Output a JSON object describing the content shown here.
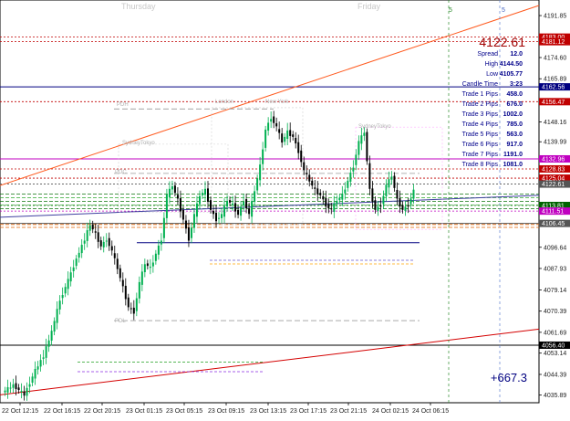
{
  "chart_data": {
    "type": "candlestick",
    "symbol_price": "4122.61",
    "y_range": [
      4035,
      4196
    ],
    "y_ticks": [
      "4191.85",
      "4183.00",
      "4181.12",
      "4174.60",
      "4165.89",
      "4162.56",
      "4156.47",
      "4148.16",
      "4139.99",
      "4132.96",
      "4128.83",
      "4125.04",
      "4122.61",
      "4113.81",
      "4111.51",
      "4106.45",
      "4096.64",
      "4087.93",
      "4079.14",
      "4070.39",
      "4061.69",
      "4056.40",
      "4053.14",
      "4044.39",
      "4035.89"
    ],
    "x_labels": [
      "22 Oct 12:15",
      "22 Oct 16:15",
      "22 Oct 20:15",
      "23 Oct 01:15",
      "23 Oct 05:15",
      "23 Oct 09:15",
      "23 Oct 13:15",
      "23 Oct 17:15",
      "23 Oct 21:15",
      "24 Oct 02:15",
      "24 Oct 06:15"
    ],
    "day_labels": [
      "Thursday",
      "Friday"
    ],
    "markers": [
      "5",
      "5"
    ],
    "session_labels": {
      "pdh": "PDH",
      "pdc": "PDC",
      "pdl": "PDL",
      "london": "London",
      "newyork": "New York",
      "sydtok1": "SydneyTokyo",
      "sydtok2": "SydneyTokyo"
    },
    "level_tags": [
      {
        "price": 4183.0,
        "label": "4183.00",
        "color": "#c00000"
      },
      {
        "price": 4181.12,
        "label": "4181.12",
        "color": "#c00000"
      },
      {
        "price": 4162.56,
        "label": "4162.56",
        "color": "#000080"
      },
      {
        "price": 4156.47,
        "label": "4156.47",
        "color": "#c00000"
      },
      {
        "price": 4132.96,
        "label": "4132.96",
        "color": "#c000c0"
      },
      {
        "price": 4128.83,
        "label": "4128.83",
        "color": "#c00000"
      },
      {
        "price": 4125.04,
        "label": "4125.04",
        "color": "#c00000"
      },
      {
        "price": 4122.61,
        "label": "4122.61",
        "color": "#555555"
      },
      {
        "price": 4113.81,
        "label": "4113.81",
        "color": "#006400"
      },
      {
        "price": 4111.51,
        "label": "4111.51",
        "color": "#c000c0"
      },
      {
        "price": 4106.45,
        "label": "4106.45",
        "color": "#555555"
      },
      {
        "price": 4056.4,
        "label": "4056.40",
        "color": "#000000"
      }
    ],
    "info_panel": [
      {
        "label": "Spread",
        "value": "12.0"
      },
      {
        "label": "High",
        "value": "4144.50"
      },
      {
        "label": "Low",
        "value": "4105.77"
      },
      {
        "label": "Candle Time",
        "value": "3:23"
      },
      {
        "label": "Trade 1 Pips",
        "value": "458.0"
      },
      {
        "label": "Trade 2 Pips",
        "value": "676.0"
      },
      {
        "label": "Trade 3 Pips",
        "value": "1002.0"
      },
      {
        "label": "Trade 4 Pips",
        "value": "785.0"
      },
      {
        "label": "Trade 5 Pips",
        "value": "563.0"
      },
      {
        "label": "Trade 6 Pips",
        "value": "917.0"
      },
      {
        "label": "Trade 7 Pips",
        "value": "1191.0"
      },
      {
        "label": "Trade 8 Pips",
        "value": "1081.0"
      }
    ],
    "pips_total": "+667.3",
    "close_path": [
      [
        0,
        4037
      ],
      [
        8,
        4040
      ],
      [
        16,
        4036
      ],
      [
        24,
        4046
      ],
      [
        30,
        4052
      ],
      [
        36,
        4062
      ],
      [
        42,
        4075
      ],
      [
        48,
        4083
      ],
      [
        54,
        4092
      ],
      [
        60,
        4100
      ],
      [
        64,
        4106
      ],
      [
        68,
        4102
      ],
      [
        72,
        4097
      ],
      [
        76,
        4100
      ],
      [
        80,
        4095
      ],
      [
        84,
        4088
      ],
      [
        88,
        4080
      ],
      [
        92,
        4072
      ],
      [
        96,
        4070
      ],
      [
        100,
        4082
      ],
      [
        104,
        4090
      ],
      [
        108,
        4088
      ],
      [
        112,
        4094
      ],
      [
        116,
        4100
      ],
      [
        120,
        4118
      ],
      [
        124,
        4122
      ],
      [
        128,
        4116
      ],
      [
        132,
        4108
      ],
      [
        136,
        4100
      ],
      [
        140,
        4110
      ],
      [
        144,
        4118
      ],
      [
        148,
        4120
      ],
      [
        152,
        4112
      ],
      [
        156,
        4108
      ],
      [
        160,
        4110
      ],
      [
        164,
        4116
      ],
      [
        168,
        4114
      ],
      [
        172,
        4110
      ],
      [
        176,
        4116
      ],
      [
        180,
        4110
      ],
      [
        184,
        4120
      ],
      [
        188,
        4130
      ],
      [
        192,
        4145
      ],
      [
        196,
        4150
      ],
      [
        200,
        4146
      ],
      [
        204,
        4140
      ],
      [
        208,
        4144
      ],
      [
        212,
        4142
      ],
      [
        216,
        4136
      ],
      [
        220,
        4128
      ],
      [
        224,
        4124
      ],
      [
        228,
        4120
      ],
      [
        232,
        4118
      ],
      [
        236,
        4114
      ],
      [
        240,
        4112
      ],
      [
        244,
        4116
      ],
      [
        248,
        4118
      ],
      [
        252,
        4124
      ],
      [
        256,
        4130
      ],
      [
        260,
        4140
      ],
      [
        264,
        4144
      ],
      [
        268,
        4120
      ],
      [
        272,
        4112
      ],
      [
        276,
        4114
      ],
      [
        280,
        4122
      ],
      [
        284,
        4126
      ],
      [
        288,
        4116
      ],
      [
        292,
        4112
      ],
      [
        296,
        4114
      ],
      [
        300,
        4120
      ]
    ]
  }
}
